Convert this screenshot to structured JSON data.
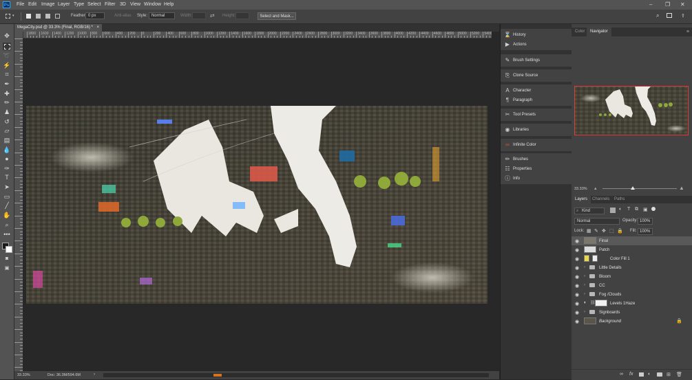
{
  "app": {
    "logo": "Ps"
  },
  "menu": [
    "File",
    "Edit",
    "Image",
    "Layer",
    "Type",
    "Select",
    "Filter",
    "3D",
    "View",
    "Window",
    "Help"
  ],
  "window_controls": {
    "minimize": "–",
    "restore": "❐",
    "close": "✕"
  },
  "options": {
    "feather_label": "Feather:",
    "feather_value": "0 px",
    "antialias_label": "Anti-alias",
    "style_label": "Style:",
    "style_value": "Normal",
    "width_label": "Width:",
    "height_label": "Height:",
    "select_mask_label": "Select and Mask..."
  },
  "document": {
    "tab_title": "MegaCity.psd @ 33.3% (Final, RGB/16) *",
    "close": "×",
    "zoom": "33.33%",
    "doc_size": "Doc: 36.3M/594.6M"
  },
  "ruler": {
    "h_labels": [
      "1800",
      "1600",
      "1400",
      "1200",
      "1000",
      "800",
      "600",
      "400",
      "200",
      "0",
      "200",
      "400",
      "600",
      "800",
      "1000",
      "1200",
      "1400",
      "1600",
      "1800",
      "2000",
      "2200",
      "2400",
      "2600",
      "2800",
      "3000",
      "3200",
      "3400",
      "3600",
      "3800",
      "4000",
      "4200",
      "4400",
      "4600",
      "4800",
      "5000",
      "5200",
      "5400"
    ]
  },
  "dock": {
    "items": [
      {
        "label": "History",
        "icon": "history-icon",
        "glyph": "⌛"
      },
      {
        "label": "Actions",
        "icon": "actions-icon",
        "glyph": "▶"
      },
      {
        "label": "Brush Settings",
        "icon": "brush-settings-icon",
        "glyph": "✎"
      },
      {
        "label": "Clone Source",
        "icon": "clone-source-icon",
        "glyph": "⎘"
      },
      {
        "label": "Character",
        "icon": "character-icon",
        "glyph": "A"
      },
      {
        "label": "Paragraph",
        "icon": "paragraph-icon",
        "glyph": "¶"
      },
      {
        "label": "Tool Presets",
        "icon": "tool-presets-icon",
        "glyph": "✂"
      },
      {
        "label": "Libraries",
        "icon": "libraries-icon",
        "glyph": "◉"
      },
      {
        "label": "Infinite Color",
        "icon": "infinite-color-icon",
        "glyph": "∞"
      },
      {
        "label": "Brushes",
        "icon": "brushes-icon",
        "glyph": "✏"
      },
      {
        "label": "Properties",
        "icon": "properties-icon",
        "glyph": "☷"
      },
      {
        "label": "Info",
        "icon": "info-icon",
        "glyph": "ⓘ"
      }
    ]
  },
  "navigator": {
    "tabs": [
      "Color",
      "Navigator"
    ],
    "active_tab": "Navigator",
    "zoom": "33.33%",
    "view_border_color": "#e03a3a"
  },
  "layers_panel": {
    "tabs": [
      "Layers",
      "Channels",
      "Paths"
    ],
    "active_tab": "Layers",
    "filter_label": "Kind",
    "blend_mode": "Normal",
    "opacity_label": "Opacity:",
    "opacity_value": "100%",
    "lock_label": "Lock:",
    "fill_label": "Fill:",
    "fill_value": "100%",
    "layers": [
      {
        "name": "Final",
        "type": "image",
        "selected": true
      },
      {
        "name": "Patch",
        "type": "image",
        "selected": false
      },
      {
        "name": "Color Fill 1",
        "type": "fill",
        "selected": false
      },
      {
        "name": "Little Details",
        "type": "group",
        "selected": false
      },
      {
        "name": "Bloom",
        "type": "group",
        "selected": false
      },
      {
        "name": "CC",
        "type": "group",
        "selected": false
      },
      {
        "name": "Fog /Clouds",
        "type": "group",
        "selected": false
      },
      {
        "name": "Levels 1Haze",
        "type": "adjustment",
        "selected": false
      },
      {
        "name": "Signboards",
        "type": "group",
        "selected": false
      },
      {
        "name": "Background",
        "type": "background",
        "selected": false
      }
    ],
    "footer_icons": [
      "link-icon",
      "fx-icon",
      "mask-icon",
      "adjustment-icon",
      "group-icon",
      "new-layer-icon",
      "trash-icon"
    ]
  },
  "colors": {
    "chrome": "#535353",
    "panel": "#424242",
    "workspace": "#282828",
    "accent": "#31a8ff",
    "fill_swatch": "#e8d84a"
  }
}
